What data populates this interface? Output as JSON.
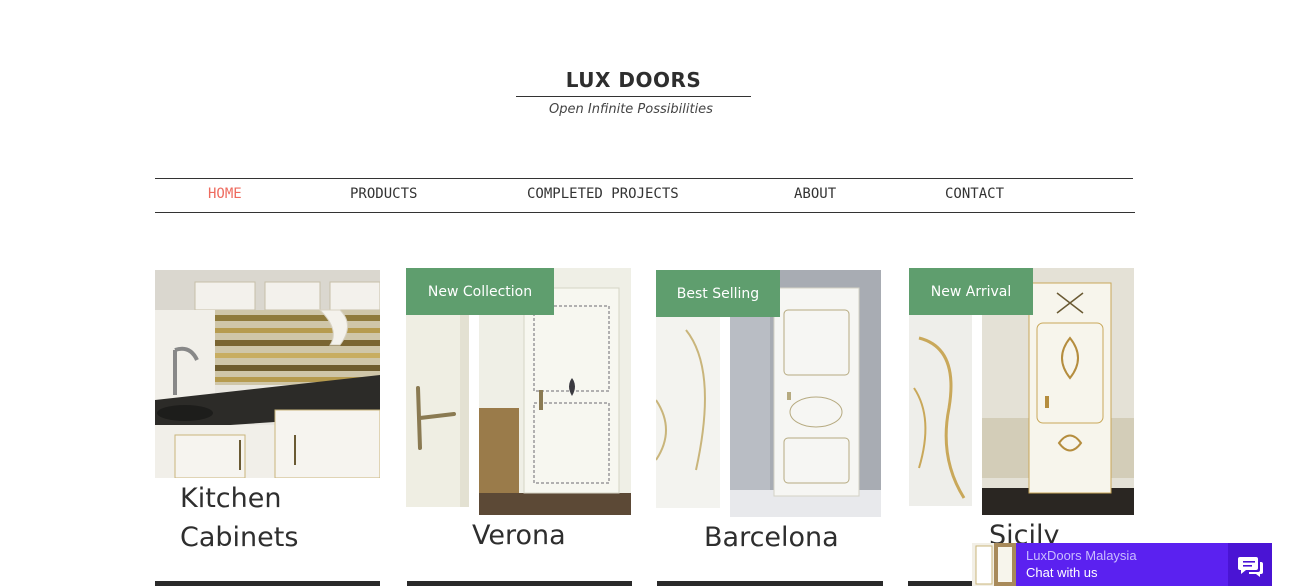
{
  "header": {
    "brand": "LUX DOORS",
    "tagline": "Open Infinite Possibilities"
  },
  "nav": {
    "items": [
      {
        "label": "HOME",
        "active": true
      },
      {
        "label": "PRODUCTS",
        "active": false
      },
      {
        "label": "COMPLETED PROJECTS",
        "active": false
      },
      {
        "label": "ABOUT",
        "active": false
      },
      {
        "label": "CONTACT",
        "active": false
      }
    ]
  },
  "cards": [
    {
      "title_line1": "Kitchen",
      "title_line2": "Cabinets",
      "badge": ""
    },
    {
      "title": "Verona",
      "badge": "New Collection"
    },
    {
      "title": "Barcelona",
      "badge": "Best Selling"
    },
    {
      "title": "Sicily",
      "badge": "New Arrival"
    }
  ],
  "chat": {
    "name": "LuxDoors Malaysia",
    "subtitle": "Chat with us",
    "icon": "chat-bubbles-icon"
  },
  "colors": {
    "active_nav": "#ee6b5f",
    "badge": "#5f9e6e",
    "chat": "#5b21f0"
  }
}
